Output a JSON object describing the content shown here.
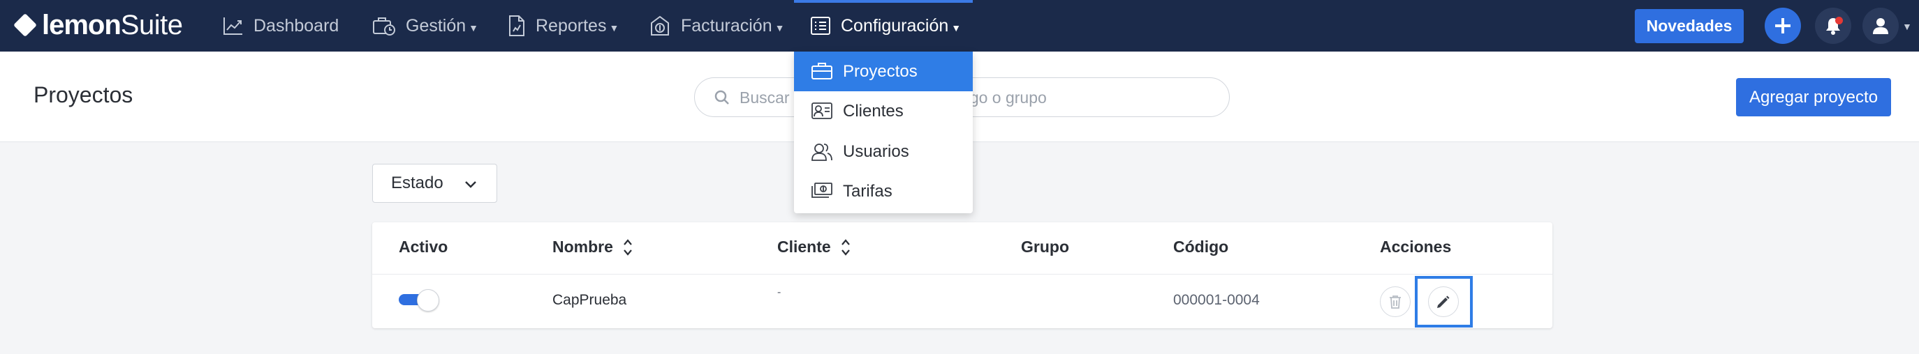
{
  "app": {
    "logo_bold": "lemon",
    "logo_light": "Suite"
  },
  "nav": {
    "items": [
      {
        "label": "Dashboard",
        "icon": "chart-line-icon",
        "has_caret": false
      },
      {
        "label": "Gestión",
        "icon": "briefcase-clock-icon",
        "has_caret": true
      },
      {
        "label": "Reportes",
        "icon": "report-document-icon",
        "has_caret": true
      },
      {
        "label": "Facturación",
        "icon": "invoice-dollar-icon",
        "has_caret": true
      },
      {
        "label": "Configuración",
        "icon": "list-settings-icon",
        "has_caret": true,
        "active": true
      }
    ],
    "novedades_label": "Novedades"
  },
  "dropdown": {
    "items": [
      {
        "label": "Proyectos",
        "icon": "briefcase-icon",
        "active": true
      },
      {
        "label": "Clientes",
        "icon": "contact-card-icon"
      },
      {
        "label": "Usuarios",
        "icon": "users-icon"
      },
      {
        "label": "Tarifas",
        "icon": "money-bills-icon"
      }
    ]
  },
  "header": {
    "title": "Proyectos",
    "search_placeholder": "Buscar por nombre, cliente, código o grupo",
    "add_button": "Agregar proyecto"
  },
  "filter": {
    "estado_label": "Estado"
  },
  "table": {
    "columns": [
      "Activo",
      "Nombre",
      "Cliente",
      "Grupo",
      "Código",
      "Acciones"
    ],
    "rows": [
      {
        "activo": true,
        "nombre": "CapPrueba",
        "cliente": "-",
        "grupo": "",
        "codigo": "000001-0004"
      }
    ]
  },
  "colors": {
    "navbar": "#1b2a4a",
    "accent": "#2f6fe0",
    "dropdown_active": "#2f7de6",
    "notification_dot": "#e53935"
  }
}
